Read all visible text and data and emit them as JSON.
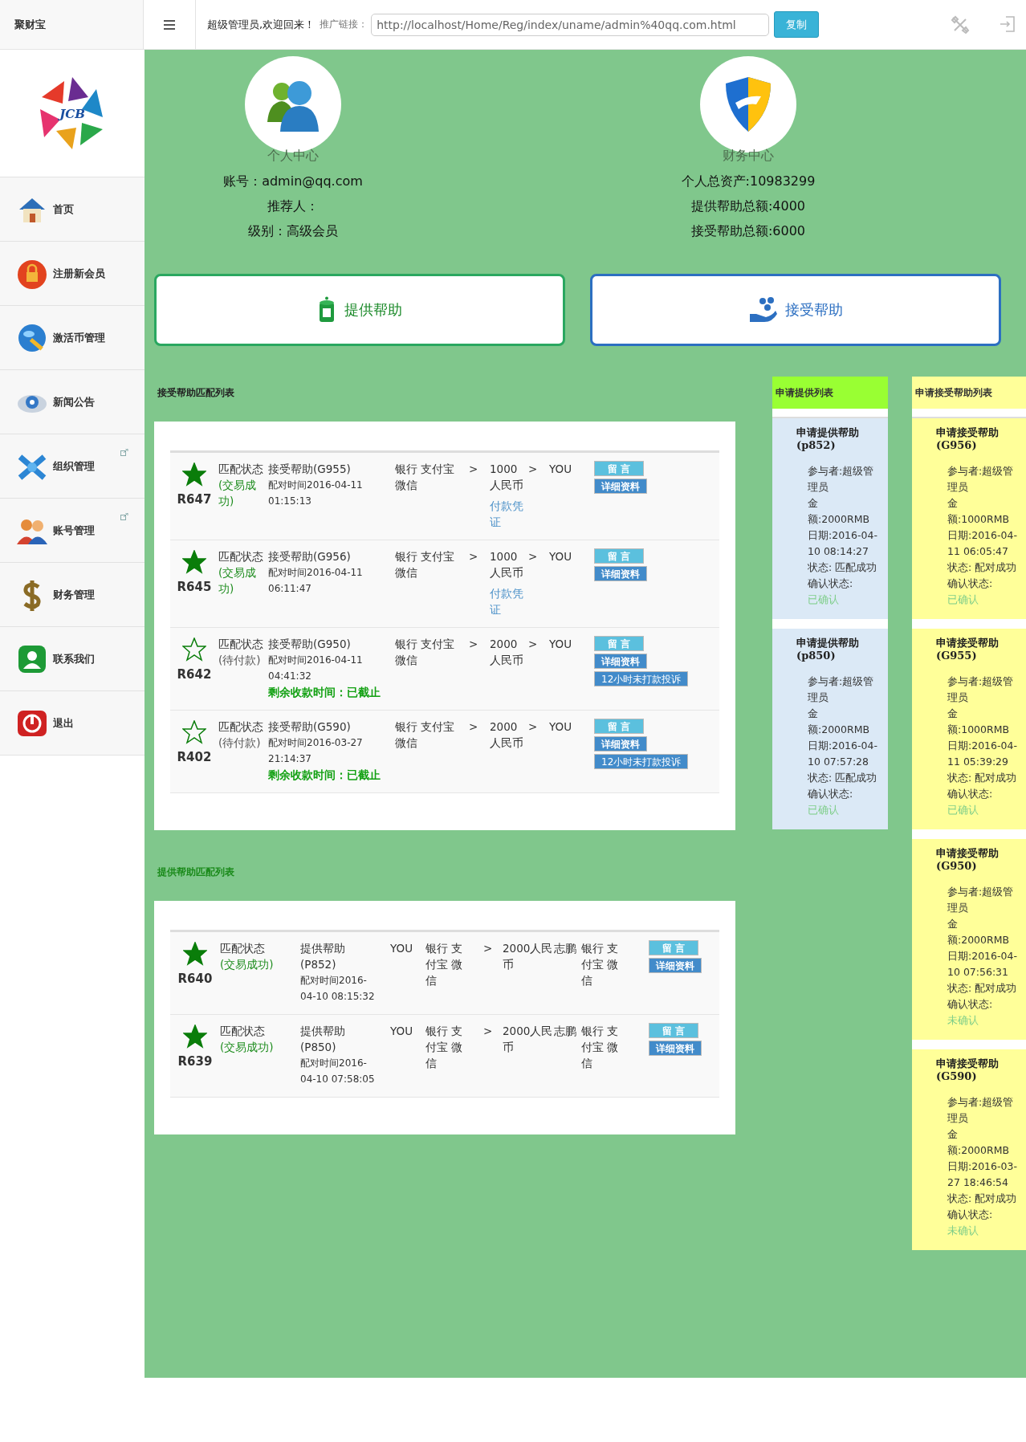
{
  "header": {
    "brand": "聚财宝",
    "welcome": "超级管理员,欢迎回来！",
    "link_label": "推广链接：",
    "link_value": "http://localhost/Home/Reg/index/uname/admin%40qq.com.html",
    "copy_button": "复制"
  },
  "sidebar": {
    "logo_text": "JCB",
    "items": [
      {
        "label": "首页",
        "kind": "home",
        "external": false
      },
      {
        "label": "注册新会员",
        "kind": "lock",
        "external": false
      },
      {
        "label": "激活币管理",
        "kind": "globe",
        "external": false
      },
      {
        "label": "新闻公告",
        "kind": "news",
        "external": false
      },
      {
        "label": "组织管理",
        "kind": "network",
        "external": true
      },
      {
        "label": "账号管理",
        "kind": "people",
        "external": true
      },
      {
        "label": "财务管理",
        "kind": "dollar",
        "external": false
      },
      {
        "label": "联系我们",
        "kind": "contact",
        "external": false
      },
      {
        "label": "退出",
        "kind": "power",
        "external": false
      }
    ]
  },
  "profile": {
    "title": "个人中心",
    "lines": [
      "账号：admin@qq.com",
      "推荐人：",
      "级别：高级会员"
    ]
  },
  "finance": {
    "title": "财务中心",
    "lines": [
      "个人总资产:10983299",
      "提供帮助总额:4000",
      "接受帮助总额:6000"
    ]
  },
  "actions": [
    {
      "label": "提供帮助",
      "kind": "provide"
    },
    {
      "label": "接受帮助",
      "kind": "accept"
    }
  ],
  "receive_matches": {
    "title": "接受帮助匹配列表",
    "rows": [
      {
        "id": "R647",
        "starred": true,
        "status_label": "匹配状态",
        "status": "(交易成功)",
        "success": true,
        "type": "接受帮助(G955)",
        "time": "配对时间2016-04-11 01:15:13",
        "methods": [
          "银行 支付宝",
          "微信"
        ],
        "arrow1": ">",
        "amount": "1000人民币",
        "proof": "付款凭证",
        "arrow2": ">",
        "receiver": "YOU",
        "buttons": [
          "留 言",
          "详细资料"
        ]
      },
      {
        "id": "R645",
        "starred": true,
        "status_label": "匹配状态",
        "status": "(交易成功)",
        "success": true,
        "type": "接受帮助(G956)",
        "time": "配对时间2016-04-11 06:11:47",
        "methods": [
          "银行 支付宝",
          "微信"
        ],
        "arrow1": ">",
        "amount": "1000人民币",
        "proof": "付款凭证",
        "arrow2": ">",
        "receiver": "YOU",
        "buttons": [
          "留 言",
          "详细资料"
        ]
      },
      {
        "id": "R642",
        "starred": false,
        "status_label": "匹配状态",
        "status": "(待付款)",
        "success": false,
        "type": "接受帮助(G950)",
        "time": "配对时间2016-04-11 04:41:32",
        "deadline": "剩余收款时间：已截止",
        "methods": [
          "银行 支付宝",
          "微信"
        ],
        "arrow1": ">",
        "amount": "2000人民币",
        "arrow2": ">",
        "receiver": "YOU",
        "buttons": [
          "留 言",
          "详细资料",
          "12小时未打款投诉"
        ]
      },
      {
        "id": "R402",
        "starred": false,
        "status_label": "匹配状态",
        "status": "(待付款)",
        "success": false,
        "type": "接受帮助(G590)",
        "time": "配对时间2016-03-27 21:14:37",
        "deadline": "剩余收款时间：已截止",
        "methods": [
          "银行 支付宝",
          "微信"
        ],
        "arrow1": ">",
        "amount": "2000人民币",
        "arrow2": ">",
        "receiver": "YOU",
        "buttons": [
          "留 言",
          "详细资料",
          "12小时未打款投诉"
        ]
      }
    ]
  },
  "provide_matches": {
    "title": "提供帮助匹配列表",
    "rows": [
      {
        "id": "R640",
        "starred": true,
        "status_label": "匹配状态",
        "status": "(交易成功)",
        "success": true,
        "type": "提供帮助(P852)",
        "time": "配对时间2016-04-10 08:15:32",
        "payer": "YOU",
        "methods": [
          "银行 支",
          "付宝 微",
          "信"
        ],
        "arrow": ">",
        "amount": "2000人民币",
        "receiver": "志鹏",
        "receiver_methods": [
          "银行 支",
          "付宝 微",
          "信"
        ],
        "buttons": [
          "留 言",
          "详细资料"
        ]
      },
      {
        "id": "R639",
        "starred": true,
        "status_label": "匹配状态",
        "status": "(交易成功)",
        "success": true,
        "type": "提供帮助(P850)",
        "time": "配对时间2016-04-10 07:58:05",
        "payer": "YOU",
        "methods": [
          "银行 支",
          "付宝 微",
          "信"
        ],
        "arrow": ">",
        "amount": "2000人民币",
        "receiver": "志鹏",
        "receiver_methods": [
          "银行 支",
          "付宝 微",
          "信"
        ],
        "buttons": [
          "留 言",
          "详细资料"
        ]
      }
    ]
  },
  "provide_requests": {
    "title": "申请提供列表",
    "items": [
      {
        "title": "申请提供帮助(p852)",
        "participant": "参与者:超级管理员",
        "amount": "金额:2000RMB",
        "date": "日期:2016-04-10 08:14:27",
        "status": "状态: 匹配成功",
        "confirm_label": "确认状态:",
        "confirm": "已确认"
      },
      {
        "title": "申请提供帮助(p850)",
        "participant": "参与者:超级管理员",
        "amount": "金额:2000RMB",
        "date": "日期:2016-04-10 07:57:28",
        "status": "状态: 匹配成功",
        "confirm_label": "确认状态:",
        "confirm": "已确认"
      }
    ]
  },
  "receive_requests": {
    "title": "申请接受帮助列表",
    "items": [
      {
        "title": "申请接受帮助(G956)",
        "participant": "参与者:超级管理员",
        "amount": "金额:1000RMB",
        "date": "日期:2016-04-11 06:05:47",
        "status": "状态: 配对成功",
        "confirm_label": "确认状态:",
        "confirm": "已确认"
      },
      {
        "title": "申请接受帮助(G955)",
        "participant": "参与者:超级管理员",
        "amount": "金额:1000RMB",
        "date": "日期:2016-04-11 05:39:29",
        "status": "状态: 配对成功",
        "confirm_label": "确认状态:",
        "confirm": "已确认"
      },
      {
        "title": "申请接受帮助(G950)",
        "participant": "参与者:超级管理员",
        "amount": "金额:2000RMB",
        "date": "日期:2016-04-10 07:56:31",
        "status": "状态: 配对成功",
        "confirm_label": "确认状态:",
        "confirm": "未确认"
      },
      {
        "title": "申请接受帮助(G590)",
        "participant": "参与者:超级管理员",
        "amount": "金额:2000RMB",
        "date": "日期:2016-03-27 18:46:54",
        "status": "状态: 配对成功",
        "confirm_label": "确认状态:",
        "confirm": "未确认"
      }
    ]
  }
}
